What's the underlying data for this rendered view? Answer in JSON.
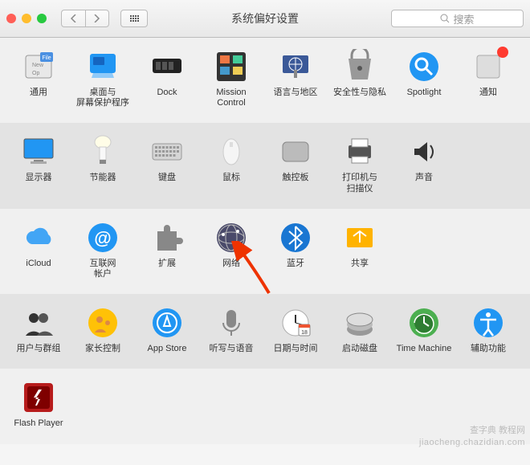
{
  "window": {
    "title": "系统偏好设置"
  },
  "search": {
    "placeholder": "搜索"
  },
  "rows": [
    {
      "style": "light",
      "items": [
        {
          "id": "general",
          "label": "通用"
        },
        {
          "id": "desktop",
          "label": "桌面与\n屏幕保护程序"
        },
        {
          "id": "dock",
          "label": "Dock"
        },
        {
          "id": "mission",
          "label": "Mission\nControl"
        },
        {
          "id": "language",
          "label": "语言与地区"
        },
        {
          "id": "security",
          "label": "安全性与隐私"
        },
        {
          "id": "spotlight",
          "label": "Spotlight"
        },
        {
          "id": "notifications",
          "label": "通知"
        }
      ]
    },
    {
      "style": "alt",
      "items": [
        {
          "id": "displays",
          "label": "显示器"
        },
        {
          "id": "energy",
          "label": "节能器"
        },
        {
          "id": "keyboard",
          "label": "键盘"
        },
        {
          "id": "mouse",
          "label": "鼠标"
        },
        {
          "id": "trackpad",
          "label": "触控板"
        },
        {
          "id": "printers",
          "label": "打印机与\n扫描仪"
        },
        {
          "id": "sound",
          "label": "声音"
        }
      ]
    },
    {
      "style": "light",
      "items": [
        {
          "id": "icloud",
          "label": "iCloud"
        },
        {
          "id": "internet",
          "label": "互联网\n帐户"
        },
        {
          "id": "extensions",
          "label": "扩展"
        },
        {
          "id": "network",
          "label": "网络"
        },
        {
          "id": "bluetooth",
          "label": "蓝牙"
        },
        {
          "id": "sharing",
          "label": "共享"
        }
      ]
    },
    {
      "style": "alt",
      "items": [
        {
          "id": "users",
          "label": "用户与群组"
        },
        {
          "id": "parental",
          "label": "家长控制"
        },
        {
          "id": "appstore",
          "label": "App Store"
        },
        {
          "id": "dictation",
          "label": "听写与语音"
        },
        {
          "id": "datetime",
          "label": "日期与时间"
        },
        {
          "id": "startup",
          "label": "启动磁盘"
        },
        {
          "id": "timemachine",
          "label": "Time Machine"
        },
        {
          "id": "accessibility",
          "label": "辅助功能"
        }
      ]
    },
    {
      "style": "light",
      "items": [
        {
          "id": "flash",
          "label": "Flash Player"
        }
      ]
    }
  ],
  "watermark": {
    "line1": "查字典 教程网",
    "line2": "jiaocheng.chazidian.com"
  }
}
